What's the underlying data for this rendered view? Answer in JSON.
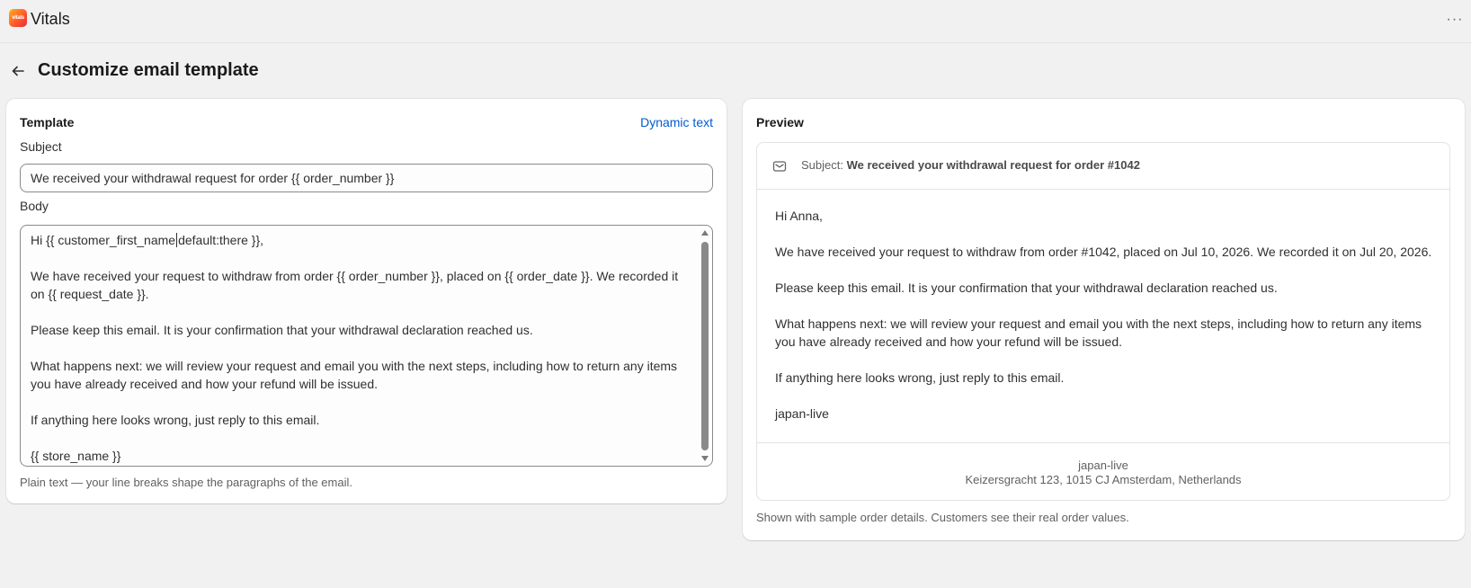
{
  "app": {
    "logo_text": "vitals",
    "title": "Vitals",
    "more_label": "···"
  },
  "page": {
    "title": "Customize email template"
  },
  "template_card": {
    "heading": "Template",
    "dynamic_text_link": "Dynamic text",
    "subject_label": "Subject",
    "subject_value": "We received your withdrawal request for order {{ order_number }}",
    "body_label": "Body",
    "body_line1_before_caret": "Hi {{ customer_first_name",
    "body_line1_after_caret": "default:there }},",
    "body_paragraphs": [
      "We have received your request to withdraw from order {{ order_number }}, placed on {{ order_date }}. We recorded it on {{ request_date }}.",
      "Please keep this email. It is your confirmation that your withdrawal declaration reached us.",
      "What happens next: we will review your request and email you with the next steps, including how to return any items you have already received and how your refund will be issued.",
      "If anything here looks wrong, just reply to this email.",
      "{{ store_name }}"
    ],
    "help_text": "Plain text — your line breaks shape the paragraphs of the email."
  },
  "preview_card": {
    "heading": "Preview",
    "subject_prefix": "Subject: ",
    "subject_value": "We received your withdrawal request for order #1042",
    "body_paragraphs": [
      "Hi Anna,",
      "We have received your request to withdraw from order #1042, placed on Jul 10, 2026. We recorded it on Jul 20, 2026.",
      "Please keep this email. It is your confirmation that your withdrawal declaration reached us.",
      "What happens next: we will review your request and email you with the next steps, including how to return any items you have already received and how your refund will be issued.",
      "If anything here looks wrong, just reply to this email.",
      "japan-live"
    ],
    "footer_store": "japan-live",
    "footer_address": "Keizersgracht 123, 1015 CJ Amsterdam, Netherlands",
    "note": "Shown with sample order details. Customers see their real order values."
  },
  "colors": {
    "link": "#005bd3",
    "background": "#f1f1f1",
    "card": "#ffffff"
  },
  "icons": [
    "app-logo-icon",
    "more-icon",
    "back-arrow-icon",
    "mail-icon"
  ]
}
